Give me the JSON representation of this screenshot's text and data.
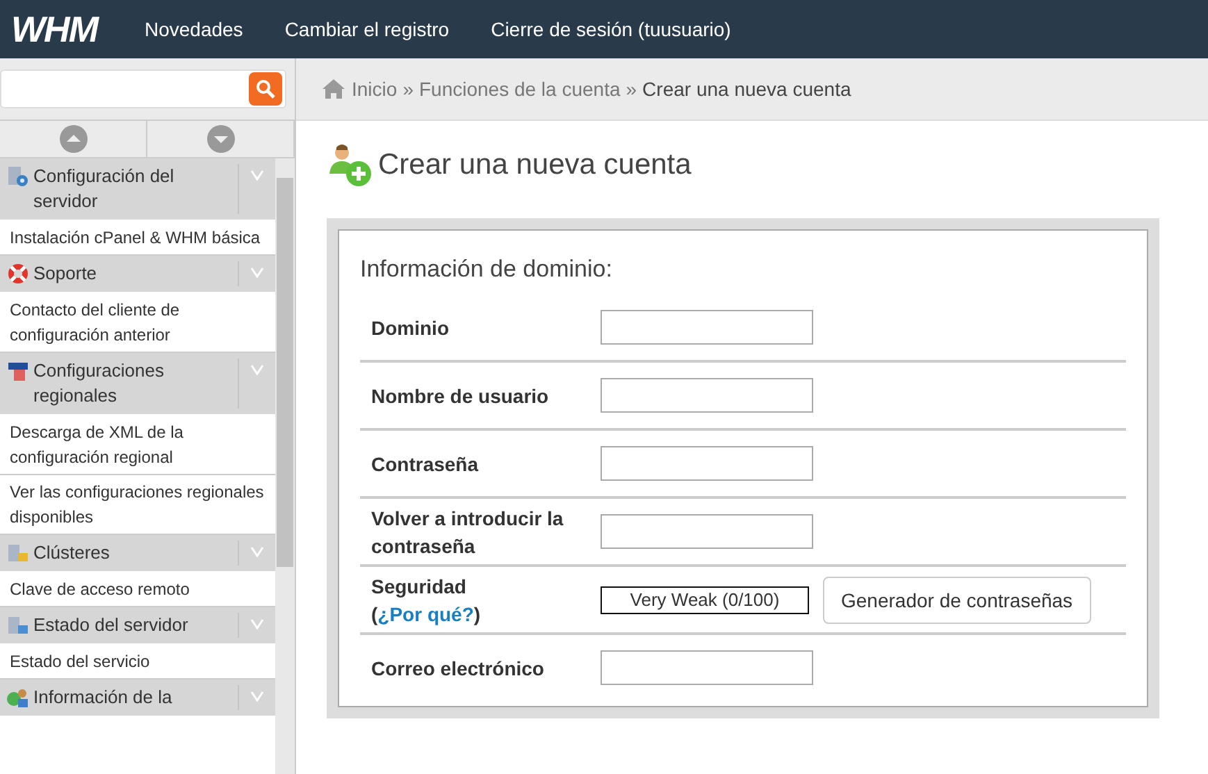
{
  "top_bar": {
    "logo": "WHM",
    "links": [
      "Novedades",
      "Cambiar el registro",
      "Cierre de sesión (tuusuario)"
    ]
  },
  "sidebar": {
    "sections": [
      {
        "title": "Configuración del servidor",
        "items": [
          "Instalación cPanel & WHM básica"
        ]
      },
      {
        "title": "Soporte",
        "items": [
          "Contacto del cliente de configuración anterior"
        ]
      },
      {
        "title": "Configuraciones regionales",
        "items": [
          "Descarga de XML de la configuración regional",
          "Ver las configuraciones regionales disponibles"
        ]
      },
      {
        "title": "Clústeres",
        "items": [
          "Clave de acceso remoto"
        ]
      },
      {
        "title": "Estado del servidor",
        "items": [
          "Estado del servicio"
        ]
      },
      {
        "title": "Información de la"
      }
    ]
  },
  "breadcrumb": {
    "items": [
      "Inicio",
      "Funciones de la cuenta",
      "Crear una nueva cuenta"
    ],
    "separators": [
      "»",
      "»"
    ]
  },
  "page_title": "Crear una nueva cuenta",
  "form": {
    "heading": "Información de dominio:",
    "rows": [
      {
        "kind": "input",
        "label": "Dominio"
      },
      {
        "kind": "input",
        "label": "Nombre de usuario"
      },
      {
        "kind": "input",
        "label": "Contraseña"
      },
      {
        "kind": "input",
        "label": "Volver a introducir la contraseña"
      },
      {
        "kind": "strength",
        "label": "Seguridad (",
        "link": "¿Por qué?",
        "label_end": ")",
        "meter": {
          "text": "Very Weak (0/100)",
          "level": 0
        },
        "button": "Generador de contraseñas"
      },
      {
        "kind": "input",
        "label": "Correo electrónico"
      }
    ]
  }
}
